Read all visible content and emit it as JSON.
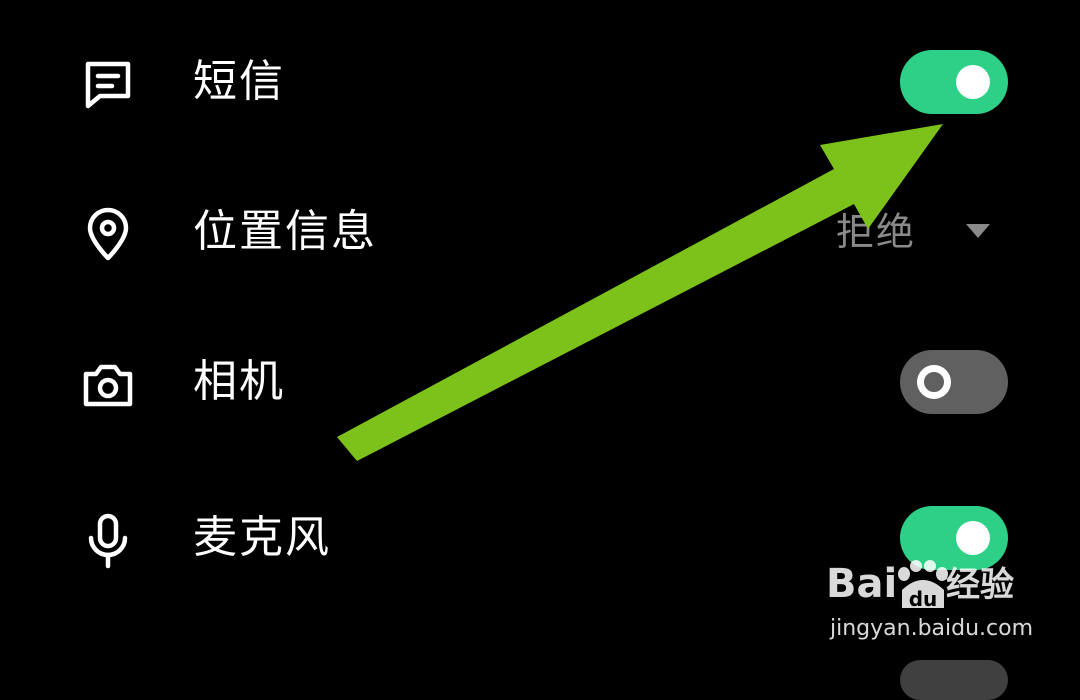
{
  "permissions": [
    {
      "label": "短信",
      "icon": "message-icon",
      "control": "toggle",
      "state": "on"
    },
    {
      "label": "位置信息",
      "icon": "location-pin-icon",
      "control": "dropdown",
      "value": "拒绝"
    },
    {
      "label": "相机",
      "icon": "camera-icon",
      "control": "toggle",
      "state": "off"
    },
    {
      "label": "麦克风",
      "icon": "microphone-icon",
      "control": "toggle",
      "state": "on"
    }
  ],
  "annotation": {
    "color": "#7cc21a",
    "icon": "arrow-icon"
  },
  "watermark": {
    "brand": "Bai",
    "brand_cn": "经验",
    "url": "jingyan.baidu.com"
  },
  "colors": {
    "toggle_on": "#2ecf86",
    "toggle_off": "#606060",
    "dropdown_text": "#8a8a8a",
    "background": "#000000"
  }
}
